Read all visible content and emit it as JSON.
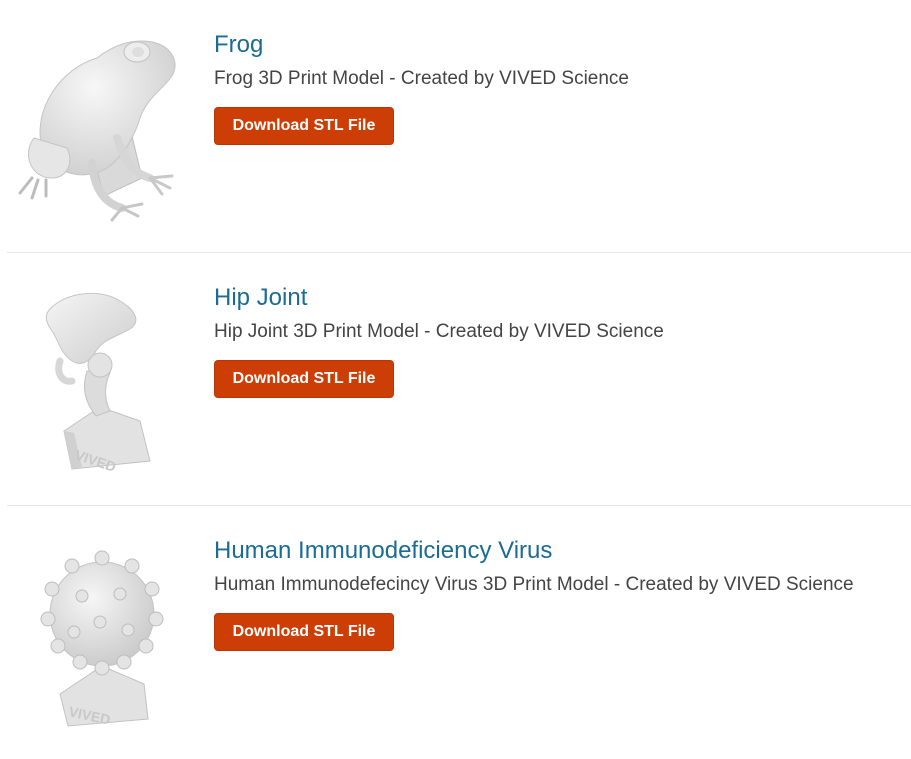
{
  "models": [
    {
      "title": "Frog",
      "description": "Frog 3D Print Model - Created by VIVED Science",
      "button_label": "Download STL File",
      "icon": "frog-model-icon"
    },
    {
      "title": "Hip Joint",
      "description": "Hip Joint 3D Print Model - Created by VIVED Science",
      "button_label": "Download STL File",
      "icon": "hip-joint-model-icon"
    },
    {
      "title": "Human Immunodeficiency Virus",
      "description": "Human Immunodefecincy Virus 3D Print Model - Created by VIVED Science",
      "button_label": "Download STL File",
      "icon": "hiv-model-icon"
    }
  ],
  "colors": {
    "title_link": "#1b6b93",
    "button": "#cd3e06",
    "description_text": "#444444",
    "divider": "#e7e7e7"
  }
}
